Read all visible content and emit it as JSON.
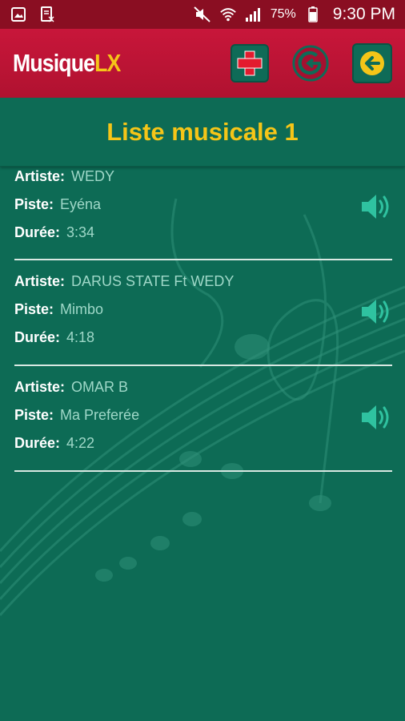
{
  "status_bar": {
    "battery": "75%",
    "time": "9:30 PM"
  },
  "app": {
    "brand_main": "Musique",
    "brand_accent": "LX"
  },
  "header": {
    "title": "Liste musicale 1"
  },
  "labels": {
    "artist": "Artiste:",
    "track": "Piste:",
    "duration": "Durée:"
  },
  "tracks": [
    {
      "artist": "WEDY",
      "track": "Eyéna",
      "duration": "3:34"
    },
    {
      "artist": "DARUS STATE Ft WEDY",
      "track": "Mimbo",
      "duration": "4:18"
    },
    {
      "artist": "OMAR B",
      "track": "Ma Preferée",
      "duration": "4:22"
    }
  ],
  "icons": {
    "add": "add-icon",
    "refresh": "refresh-icon",
    "back": "back-icon",
    "speaker": "speaker-icon"
  },
  "colors": {
    "status_bar": "#8a0e22",
    "app_bar": "#c8163a",
    "background": "#0d6b55",
    "accent_yellow": "#f5c518",
    "value_text": "#9fd8c8"
  }
}
